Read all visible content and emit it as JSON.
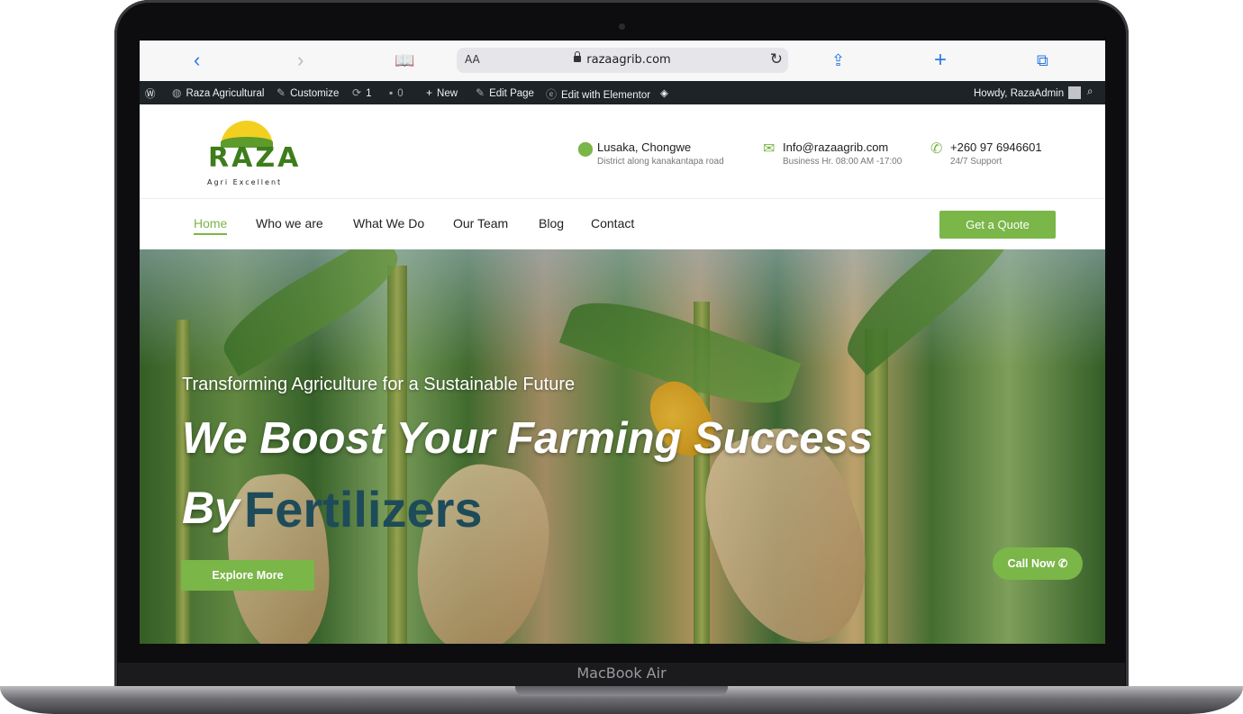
{
  "device": {
    "label": "MacBook Air"
  },
  "browser": {
    "url_prefix": "AA",
    "url": "razaagrib.com"
  },
  "wpbar": {
    "site_name": "Raza Agricultural",
    "customize": "Customize",
    "updates": "1",
    "comments": "0",
    "new": "New",
    "edit_page": "Edit Page",
    "edit_elementor": "Edit with Elementor",
    "howdy": "Howdy, RazaAdmin"
  },
  "logo": {
    "name": "RAZA",
    "tagline": "Agri Excellent"
  },
  "contacts": [
    {
      "title": "Lusaka, Chongwe",
      "sub": "District along kanakantapa road",
      "icon": "map-pin-icon"
    },
    {
      "title": "Info@razaagrib.com",
      "sub": "Business Hr. 08:00 AM -17:00",
      "icon": "mail-icon"
    },
    {
      "title": "+260 97 6946601",
      "sub": "24/7 Support",
      "icon": "phone-icon"
    }
  ],
  "nav": {
    "items": [
      "Home",
      "Who we are",
      "What We Do",
      "Our Team",
      "Blog",
      "Contact"
    ],
    "active": "Home",
    "cta": "Get a Quote"
  },
  "hero": {
    "subtitle": "Transforming Agriculture for a Sustainable Future",
    "title": "We Boost Your Farming Success",
    "by": "By",
    "highlight": "Fertilizers",
    "explore": "Explore More",
    "call": "Call Now"
  },
  "colors": {
    "accent": "#7ab648",
    "highlight": "#1e4b5a",
    "wpbar": "#1d2327"
  }
}
